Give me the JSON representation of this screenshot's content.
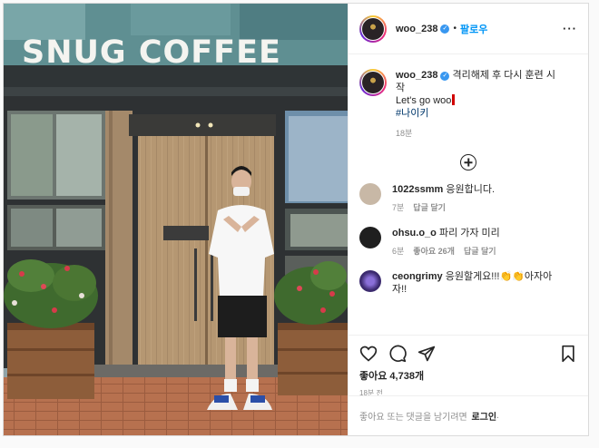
{
  "photo": {
    "sign_text": "SNUG COFFEE"
  },
  "header": {
    "username": "woo_238",
    "verified_mark": "✓",
    "separator": "•",
    "follow_label": "팔로우",
    "more_label": "···"
  },
  "caption": {
    "username": "woo_238",
    "text_line1": "격리해제 후 다시 훈련 시",
    "text_line2": "작",
    "text_line3": "Let's go woo",
    "hashtag": "#나이키",
    "age": "18분"
  },
  "comments": [
    {
      "username": "1022ssmm",
      "text": "응원합니다.",
      "age": "7분",
      "reply": "답글 달기",
      "likes": "",
      "avatar_color": "#c8b8a6"
    },
    {
      "username": "ohsu.o_o",
      "text": "파리 가자 미리",
      "age": "6분",
      "reply": "답글 달기",
      "likes": "좋아요 26개",
      "avatar_color": "#1f1f1f"
    },
    {
      "username": "ceongrimy",
      "text": "응원할게요!!!👏👏아자아",
      "text2": "자!!",
      "age": "",
      "reply": "",
      "likes": "",
      "avatar_color": "#3b2a6e"
    }
  ],
  "actions": {
    "icons": [
      "heart-icon",
      "comment-icon",
      "share-icon",
      "bookmark-icon"
    ],
    "likes": "좋아요 4,738개",
    "time": "18분 전"
  },
  "footer": {
    "prompt": "좋아요 또는 댓글을 남기려면",
    "login": "로그인",
    "suffix": "."
  },
  "colors": {
    "link": "#0095f6",
    "verified": "#3897f0",
    "muted": "#8e8e8e",
    "text": "#262626"
  }
}
